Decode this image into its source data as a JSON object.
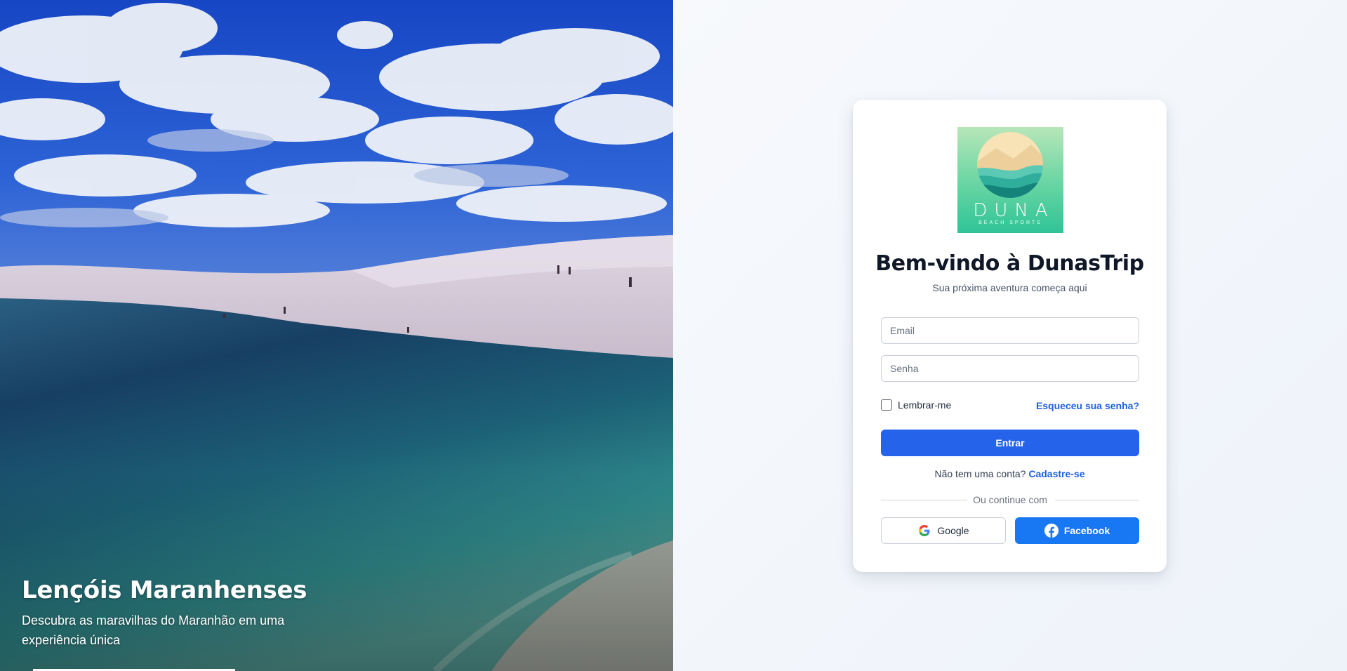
{
  "hero": {
    "title": "Lençóis Maranhenses",
    "subtitle": "Descubra as maravilhas do Maranhão em uma experiência única"
  },
  "card": {
    "logo": {
      "wordmark": "DUNA",
      "tagline": "BEACH SPORTS"
    },
    "title": "Bem-vindo à DunasTrip",
    "subtitle": "Sua próxima aventura começa aqui",
    "email": {
      "placeholder": "Email",
      "value": ""
    },
    "password": {
      "placeholder": "Senha",
      "value": ""
    },
    "remember_label": "Lembrar-me",
    "remember_checked": false,
    "forgot_label": "Esqueceu sua senha?",
    "submit_label": "Entrar",
    "signup_prompt": "Não tem uma conta?",
    "signup_link": "Cadastre-se",
    "divider_label": "Ou continue com",
    "google_label": "Google",
    "facebook_label": "Facebook"
  },
  "colors": {
    "primary": "#2563eb",
    "link": "#1d5fe0",
    "facebook": "#1877f2",
    "heading": "#101828"
  }
}
